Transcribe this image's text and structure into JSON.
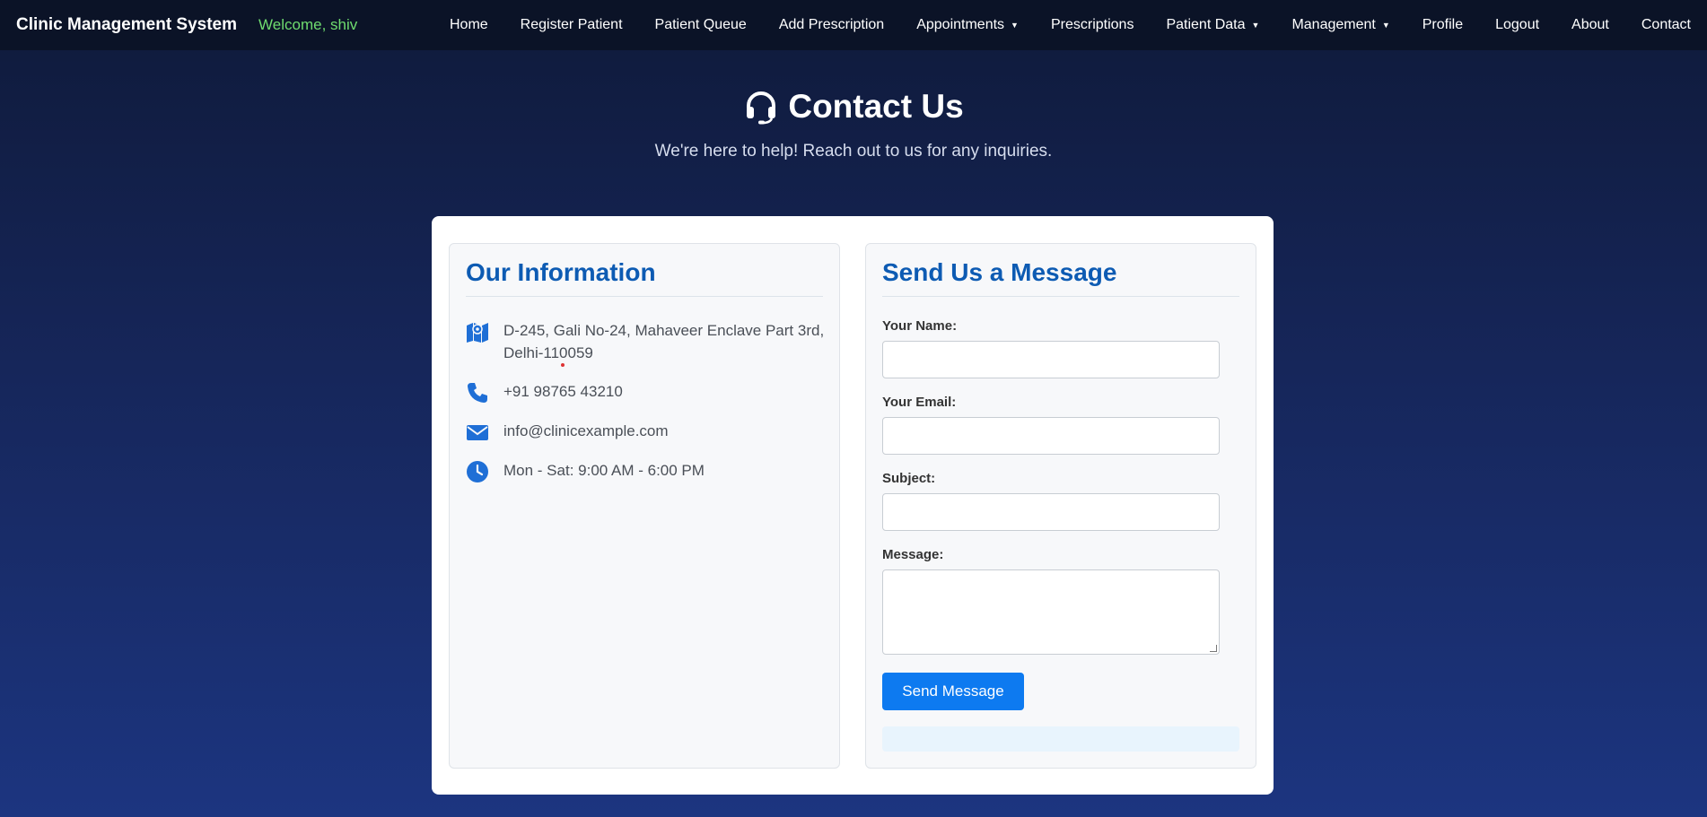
{
  "navbar": {
    "brand": "Clinic Management System",
    "welcome": "Welcome, shiv",
    "items": [
      {
        "label": "Home",
        "dropdown": false
      },
      {
        "label": "Register Patient",
        "dropdown": false
      },
      {
        "label": "Patient Queue",
        "dropdown": false
      },
      {
        "label": "Add Prescription",
        "dropdown": false
      },
      {
        "label": "Appointments",
        "dropdown": true
      },
      {
        "label": "Prescriptions",
        "dropdown": false
      },
      {
        "label": "Patient Data",
        "dropdown": true
      },
      {
        "label": "Management",
        "dropdown": true
      },
      {
        "label": "Profile",
        "dropdown": false
      },
      {
        "label": "Logout",
        "dropdown": false
      },
      {
        "label": "About",
        "dropdown": false
      },
      {
        "label": "Contact",
        "dropdown": false
      }
    ]
  },
  "header": {
    "icon": "headset-icon",
    "title": "Contact Us",
    "subtitle": "We're here to help! Reach out to us for any inquiries."
  },
  "info": {
    "title": "Our Information",
    "address": "D-245, Gali No-24, Mahaveer Enclave Part 3rd, Delhi-110059",
    "phone": "+91 98765 43210",
    "email": "info@clinicexample.com",
    "hours": "Mon - Sat: 9:00 AM - 6:00 PM"
  },
  "form": {
    "title": "Send Us a Message",
    "name_label": "Your Name:",
    "email_label": "Your Email:",
    "subject_label": "Subject:",
    "message_label": "Message:",
    "name_value": "",
    "email_value": "",
    "subject_value": "",
    "message_value": "",
    "submit_label": "Send Message"
  },
  "colors": {
    "accent": "#0d7af0",
    "heading": "#0d5bb3",
    "welcome": "#6fdc6f"
  }
}
